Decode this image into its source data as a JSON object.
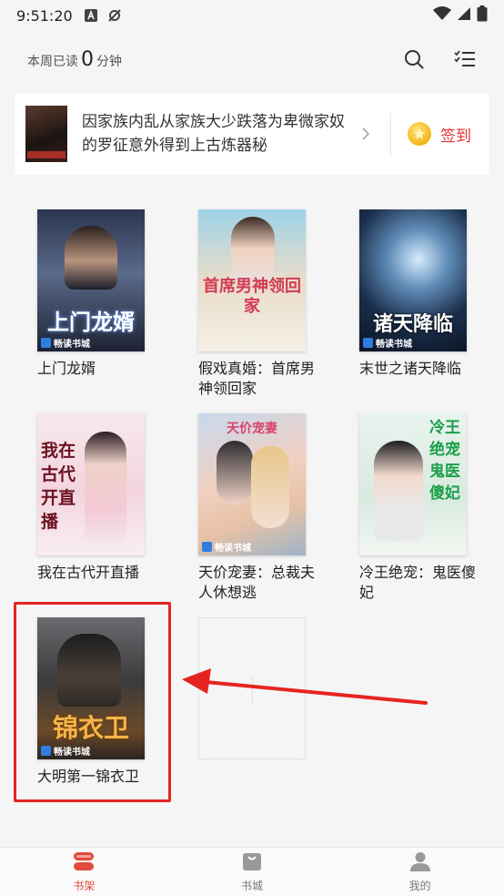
{
  "status_bar": {
    "time": "9:51:20"
  },
  "header": {
    "reading_prefix": "本周已读",
    "reading_minutes": "0",
    "reading_suffix": "分钟"
  },
  "promo": {
    "text": "因家族内乱从家族大少跌落为卑微家奴的罗征意外得到上古炼器秘",
    "signin_label": "签到"
  },
  "books": [
    {
      "title": "上门龙婿",
      "cover_art": "上门龙婿",
      "brand": "畅读书城"
    },
    {
      "title": "假戏真婚：首席男神领回家",
      "cover_art": "首席男神领回家",
      "brand": ""
    },
    {
      "title": "末世之诸天降临",
      "cover_art": "诸天降临",
      "brand": "畅读书城"
    },
    {
      "title": "我在古代开直播",
      "cover_art": "我在古代开直播",
      "brand": ""
    },
    {
      "title": "天价宠妻：总裁夫人休想逃",
      "cover_art": "天价宠妻",
      "brand": "畅读书城"
    },
    {
      "title": "冷王绝宠：鬼医傻妃",
      "cover_art": "冷王绝宠鬼医傻妃",
      "brand": ""
    },
    {
      "title": "大明第一锦衣卫",
      "cover_art": "锦衣卫",
      "brand": "畅读书城"
    }
  ],
  "bottom_nav": [
    {
      "label": "书架",
      "active": true
    },
    {
      "label": "书城",
      "active": false
    },
    {
      "label": "我的",
      "active": false
    }
  ],
  "colors": {
    "accent": "#e14a3c",
    "highlight": "#e52421",
    "signin": "#e1342f"
  }
}
